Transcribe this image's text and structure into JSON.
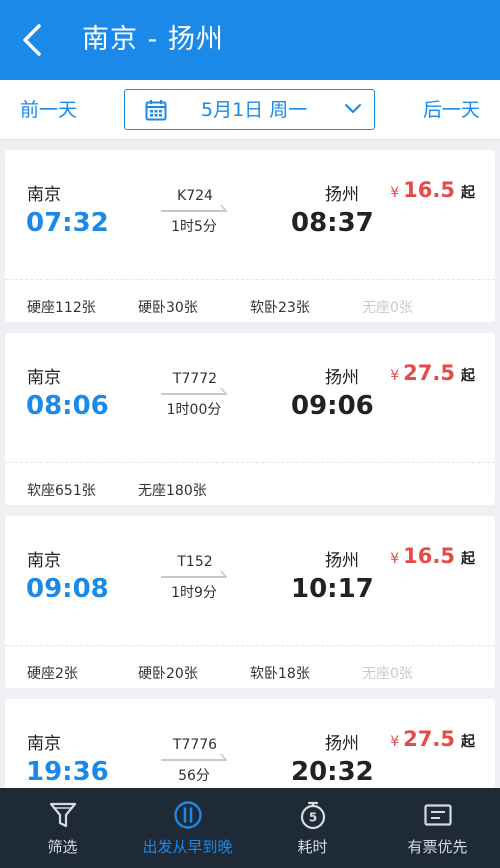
{
  "header": {
    "back_icon": "chevron-left-icon",
    "title": "南京 - 扬州"
  },
  "datebar": {
    "prev_label": "前一天",
    "next_label": "后一天",
    "date_label": "5月1日 周一"
  },
  "colors": {
    "brand": "#1b89e8",
    "price": "#e64a4a",
    "tabbar": "#1e2a35"
  },
  "trains": [
    {
      "from": "南京",
      "dep_time": "07:32",
      "train_no": "K724",
      "duration": "1时5分",
      "to": "扬州",
      "arr_time": "08:37",
      "currency": "¥",
      "price": "16.5",
      "price_suffix": "起",
      "seats": [
        {
          "label": "硬座112张",
          "available": true
        },
        {
          "label": "硬卧30张",
          "available": true
        },
        {
          "label": "软卧23张",
          "available": true
        },
        {
          "label": "无座0张",
          "available": false
        }
      ]
    },
    {
      "from": "南京",
      "dep_time": "08:06",
      "train_no": "T7772",
      "duration": "1时00分",
      "to": "扬州",
      "arr_time": "09:06",
      "currency": "¥",
      "price": "27.5",
      "price_suffix": "起",
      "seats": [
        {
          "label": "软座651张",
          "available": true
        },
        {
          "label": "无座180张",
          "available": true
        }
      ]
    },
    {
      "from": "南京",
      "dep_time": "09:08",
      "train_no": "T152",
      "duration": "1时9分",
      "to": "扬州",
      "arr_time": "10:17",
      "currency": "¥",
      "price": "16.5",
      "price_suffix": "起",
      "seats": [
        {
          "label": "硬座2张",
          "available": true
        },
        {
          "label": "硬卧20张",
          "available": true
        },
        {
          "label": "软卧18张",
          "available": true
        },
        {
          "label": "无座0张",
          "available": false
        }
      ]
    },
    {
      "from": "南京",
      "dep_time": "19:36",
      "train_no": "T7776",
      "duration": "56分",
      "to": "扬州",
      "arr_time": "20:32",
      "currency": "¥",
      "price": "27.5",
      "price_suffix": "起",
      "seats": []
    }
  ],
  "tabbar": [
    {
      "label": "筛选",
      "icon": "filter-icon",
      "active": false
    },
    {
      "label": "出发从早到晚",
      "icon": "sort-time-icon",
      "active": true
    },
    {
      "label": "耗时",
      "icon": "timer-icon",
      "active": false
    },
    {
      "label": "有票优先",
      "icon": "ticket-icon",
      "active": false
    }
  ]
}
